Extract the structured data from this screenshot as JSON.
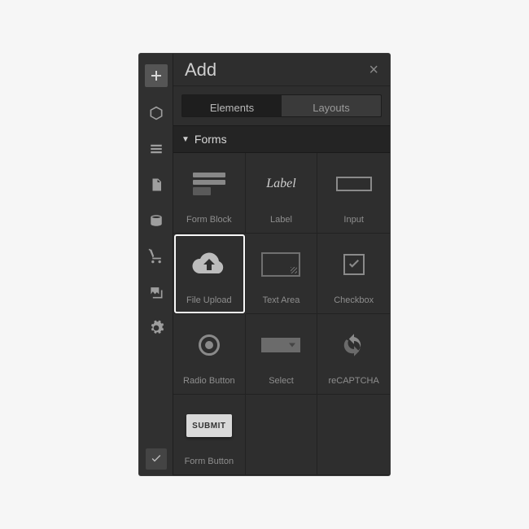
{
  "header": {
    "title": "Add"
  },
  "tabs": {
    "elements": "Elements",
    "layouts": "Layouts"
  },
  "section": {
    "forms": "Forms"
  },
  "cells": {
    "form_block": "Form Block",
    "label": "Label",
    "input": "Input",
    "file_upload": "File Upload",
    "text_area": "Text Area",
    "checkbox": "Checkbox",
    "radio_button": "Radio Button",
    "select": "Select",
    "recaptcha": "reCAPTCHA",
    "form_button": "Form Button"
  },
  "submit_text": "SUBMIT",
  "label_word": "Label"
}
